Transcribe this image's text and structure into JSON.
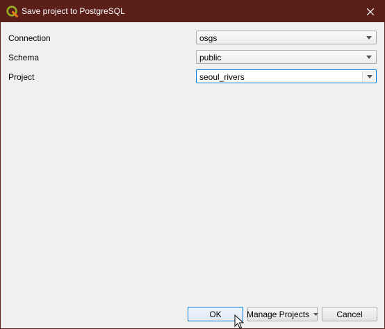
{
  "window": {
    "title": "Save project to PostgreSQL",
    "app_icon": "qgis-logo-icon",
    "close_icon": "close-icon",
    "accent_color": "#5b1f1a"
  },
  "form": {
    "connection": {
      "label": "Connection",
      "value": "osgs"
    },
    "schema": {
      "label": "Schema",
      "value": "public"
    },
    "project": {
      "label": "Project",
      "value": "seoul_rivers"
    }
  },
  "buttons": {
    "ok": "OK",
    "manage_projects": "Manage Projects",
    "cancel": "Cancel"
  }
}
